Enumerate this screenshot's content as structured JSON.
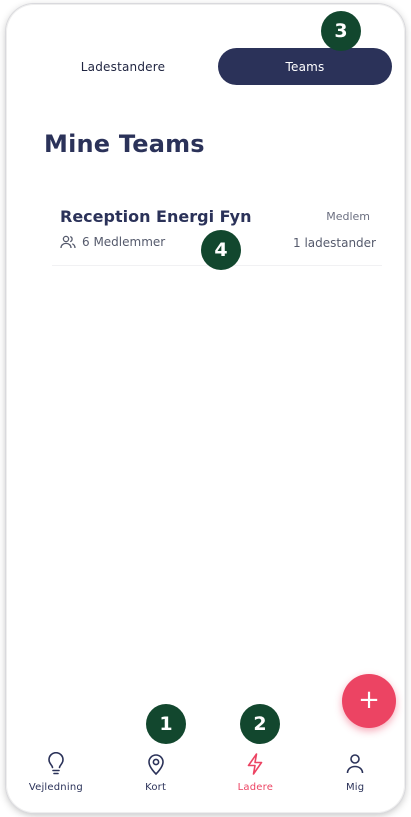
{
  "tabs": {
    "chargers_label": "Ladestandere",
    "teams_label": "Teams"
  },
  "page_title": "Mine Teams",
  "teams": [
    {
      "name": "Reception Energi Fyn",
      "role": "Medlem",
      "members": "6 Medlemmer",
      "chargers": "1 ladestander"
    }
  ],
  "fab": {
    "label": "+"
  },
  "nav": {
    "items": [
      {
        "label": "Vejledning",
        "icon": "lightbulb-icon"
      },
      {
        "label": "Kort",
        "icon": "map-pin-icon"
      },
      {
        "label": "Ladere",
        "icon": "lightning-icon",
        "active": true
      },
      {
        "label": "Mig",
        "icon": "user-icon"
      }
    ]
  },
  "annotations": [
    "1",
    "2",
    "3",
    "4"
  ],
  "colors": {
    "primary": "#2b3259",
    "accent": "#ec4463",
    "badge": "#12472e"
  }
}
